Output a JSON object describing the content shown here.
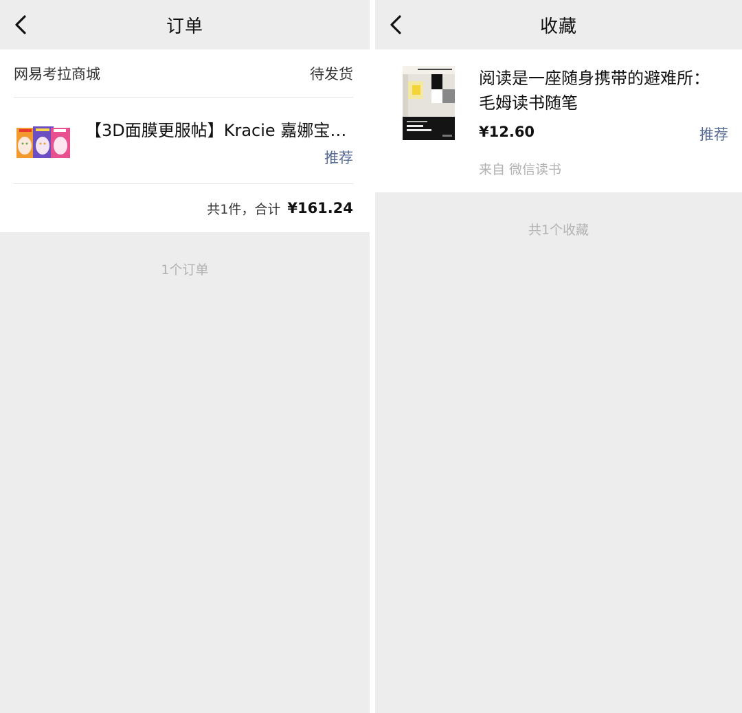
{
  "orders": {
    "title": "订单",
    "shop_name": "网易考拉商城",
    "status": "待发货",
    "item": {
      "title": "【3D面膜更服帖】Kracie 嘉娜宝…",
      "recommend_label": "推荐",
      "image_icon": "product-face-mask-image"
    },
    "total_label": "共1件，合计",
    "total_amount": "¥161.24",
    "count_text": "1个订单"
  },
  "favorites": {
    "title": "收藏",
    "item": {
      "title": "阅读是一座随身携带的避难所：毛姆读书随笔",
      "price": "¥12.60",
      "recommend_label": "推荐",
      "source": "来自 微信读书",
      "cover_icon": "book-cover-image"
    },
    "count_text": "共1个收藏"
  },
  "icons": {
    "back": "chevron-left-icon"
  },
  "colors": {
    "background": "#ededed",
    "card": "#ffffff",
    "link": "#576b95",
    "muted": "#b2b2b2"
  }
}
